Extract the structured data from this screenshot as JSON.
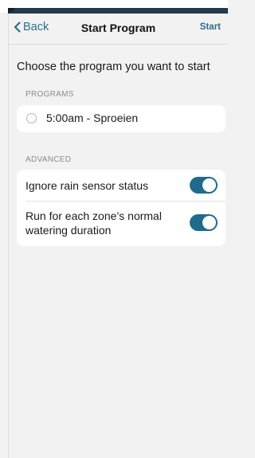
{
  "nav": {
    "back_label": "Back",
    "title": "Start Program",
    "start_label": "Start"
  },
  "heading": "Choose the program you want to start",
  "programs": {
    "section_label": "PROGRAMS",
    "items": [
      {
        "label": "5:00am - Sproeien",
        "selected": false
      }
    ]
  },
  "advanced": {
    "section_label": "ADVANCED",
    "items": [
      {
        "label": "Ignore rain sensor status",
        "enabled": true
      },
      {
        "label": "Run for each zone’s normal watering duration",
        "enabled": true
      }
    ]
  },
  "colors": {
    "accent": "#2a6f8a",
    "toggle_on": "#1f6b8c",
    "background": "#f2f2f2",
    "header_bar": "#1f3b4c"
  }
}
